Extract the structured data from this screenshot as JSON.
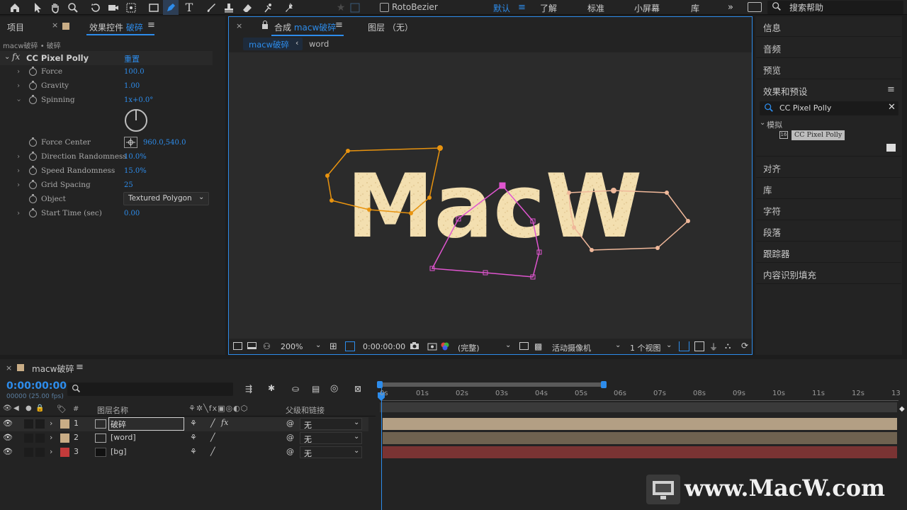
{
  "toolbar": {
    "rotobezier_label": "RotoBezier",
    "workspaces": [
      "默认",
      "了解",
      "标准",
      "小屏幕",
      "库"
    ],
    "search_placeholder": "搜索帮助"
  },
  "left_panel": {
    "tab_project": "项目",
    "tab_effects_prefix": "效果控件",
    "tab_effects_layer": "破碎",
    "breadcrumb": "macw破碎 • 破碎",
    "effect_name": "CC Pixel Polly",
    "reset_label": "重置",
    "properties": [
      {
        "name": "Force",
        "value": "100.0"
      },
      {
        "name": "Gravity",
        "value": "1.00"
      },
      {
        "name": "Spinning",
        "value": "1x+0.0°"
      },
      {
        "name": "Force Center",
        "value": "960.0,540.0"
      },
      {
        "name": "Direction Randomness",
        "value": "10.0%"
      },
      {
        "name": "Speed Randomness",
        "value": "15.0%"
      },
      {
        "name": "Grid Spacing",
        "value": "25"
      },
      {
        "name": "Object",
        "value": "Textured Polygon"
      },
      {
        "name": "Start Time (sec)",
        "value": "0.00"
      }
    ]
  },
  "composition": {
    "tab_comp_prefix": "合成",
    "tab_comp_name": "macw破碎",
    "tab_layer": "图层 （无）",
    "flow_active": "macw破碎",
    "flow_next": "word",
    "canvas_text": "MacW",
    "footer": {
      "zoom": "200%",
      "timecode": "0:00:00:00",
      "resolution": "(完整)",
      "camera": "活动摄像机",
      "views": "1 个视图"
    }
  },
  "right_panel": {
    "items_top": [
      "信息",
      "音频",
      "预览"
    ],
    "effects_presets_title": "效果和预设",
    "search_value": "CC Pixel Polly",
    "category": "模拟",
    "result": "CC Pixel Polly",
    "items_bottom": [
      "对齐",
      "库",
      "字符",
      "段落",
      "跟踪器",
      "内容识别填充"
    ]
  },
  "timeline": {
    "tab_name": "macw破碎",
    "timecode": "0:00:00:00",
    "frame_info": "00000 (25.00 fps)",
    "col_hash": "#",
    "col_layer_name": "图层名称",
    "col_parent": "父级和链接",
    "ruler_ticks": [
      "0s",
      "01s",
      "02s",
      "03s",
      "04s",
      "05s",
      "06s",
      "07s",
      "08s",
      "09s",
      "10s",
      "11s",
      "12s",
      "13"
    ],
    "layers": [
      {
        "num": "1",
        "name": "破碎",
        "parent": "无",
        "color": "#c9ad86"
      },
      {
        "num": "2",
        "name": "[word]",
        "parent": "无",
        "color": "#c9ad86"
      },
      {
        "num": "3",
        "name": "[bg]",
        "parent": "无",
        "color": "#c43b3b"
      }
    ]
  },
  "watermark": "www.MacW.com",
  "colors": {
    "accent_blue": "#2d8ceb",
    "panel_bg": "#232323",
    "orange_path": "#e8930f",
    "pink_path": "#e055d0",
    "peach_path": "#f0b89a"
  }
}
